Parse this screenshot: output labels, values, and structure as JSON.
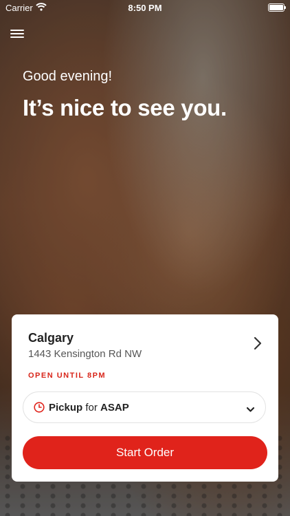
{
  "status_bar": {
    "carrier": "Carrier",
    "time": "8:50 PM"
  },
  "header": {
    "greeting": "Good evening!",
    "headline": "It’s nice to see you."
  },
  "location": {
    "city": "Calgary",
    "address": "1443 Kensington Rd NW",
    "hours": "OPEN UNTIL 8PM"
  },
  "order_mode": {
    "method": "Pickup",
    "connector": "for",
    "time": "ASAP"
  },
  "actions": {
    "start_label": "Start Order"
  },
  "colors": {
    "accent": "#e0231b",
    "hours_text": "#d8261a"
  },
  "icons": [
    "wifi-icon",
    "battery-icon",
    "menu-icon",
    "chevron-right-icon",
    "clock-icon",
    "chevron-down-icon"
  ]
}
